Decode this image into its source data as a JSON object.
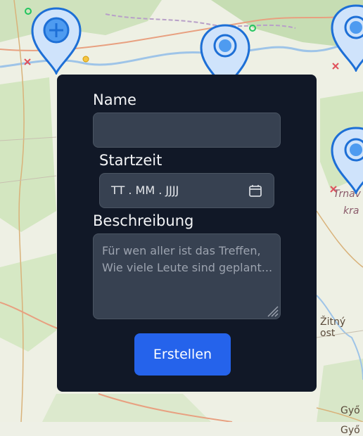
{
  "map": {
    "labels": [
      "Trnav",
      "kra",
      "Žitný ost",
      "Győ"
    ]
  },
  "form": {
    "name_label": "Name",
    "name_value": "",
    "start_label": "Startzeit",
    "start_placeholder": "TT . MM . JJJJ",
    "description_label": "Beschreibung",
    "description_placeholder": "Für wen aller ist das Treffen,\nWie viele Leute sind geplant...",
    "submit_label": "Erstellen"
  },
  "colors": {
    "panel": "#111827",
    "input_bg": "#374151",
    "accent": "#2563eb",
    "pin_fill": "#cfe3fb",
    "pin_stroke": "#1d6fd6"
  },
  "icons": [
    "add-location-icon",
    "location-pin-icon",
    "calendar-icon",
    "resize-handle-icon"
  ]
}
